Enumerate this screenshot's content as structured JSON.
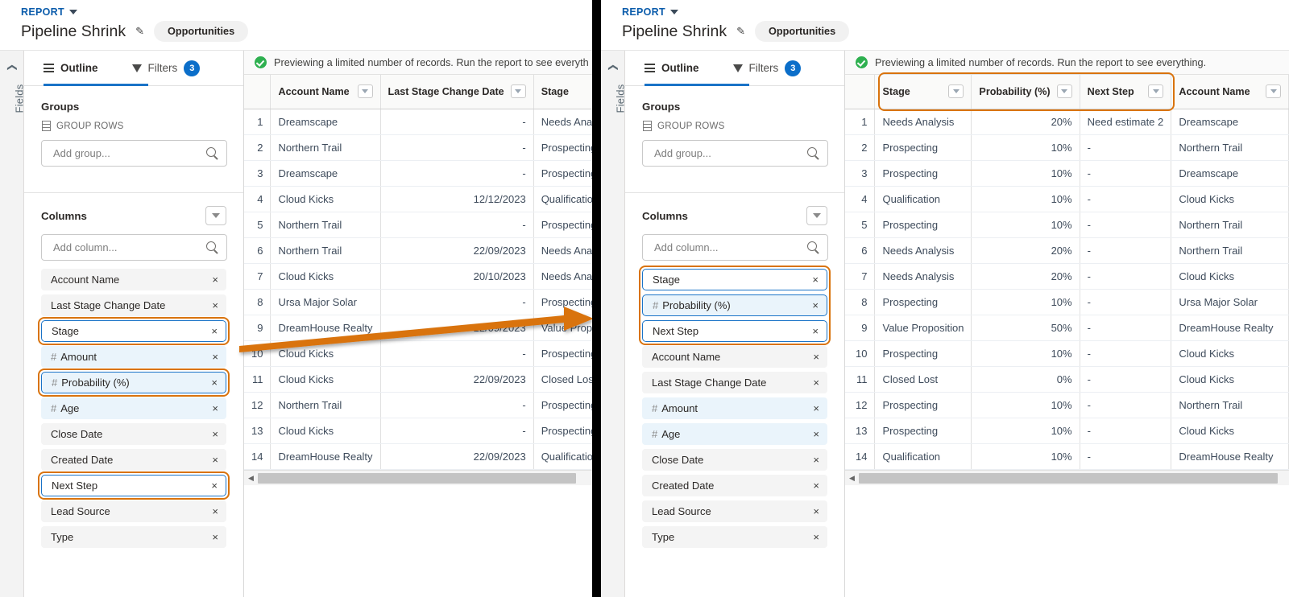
{
  "app": {
    "report_link": "REPORT",
    "report_title": "Pipeline Shrink",
    "object_pill": "Opportunities",
    "fields_rail_label": "Fields",
    "edit_icon": "pencil-icon"
  },
  "outline": {
    "tab_outline": "Outline",
    "tab_filters": "Filters",
    "filters_count": "3",
    "groups_title": "Groups",
    "group_rows_label": "GROUP ROWS",
    "add_group_placeholder": "Add group...",
    "columns_title": "Columns",
    "add_column_placeholder": "Add column...",
    "remove_glyph": "×"
  },
  "columns_left": [
    {
      "label": "Account Name",
      "numeric": false,
      "selected": false,
      "highlighted": false
    },
    {
      "label": "Last Stage Change Date",
      "numeric": false,
      "selected": false,
      "highlighted": false
    },
    {
      "label": "Stage",
      "numeric": false,
      "selected": true,
      "highlighted": true
    },
    {
      "label": "Amount",
      "numeric": true,
      "selected": false,
      "highlighted": false
    },
    {
      "label": "Probability (%)",
      "numeric": true,
      "selected": true,
      "highlighted": true
    },
    {
      "label": "Age",
      "numeric": true,
      "selected": false,
      "highlighted": false
    },
    {
      "label": "Close Date",
      "numeric": false,
      "selected": false,
      "highlighted": false
    },
    {
      "label": "Created Date",
      "numeric": false,
      "selected": false,
      "highlighted": false
    },
    {
      "label": "Next Step",
      "numeric": false,
      "selected": true,
      "highlighted": true
    },
    {
      "label": "Lead Source",
      "numeric": false,
      "selected": false,
      "highlighted": false
    },
    {
      "label": "Type",
      "numeric": false,
      "selected": false,
      "highlighted": false
    }
  ],
  "columns_right": [
    {
      "label": "Stage",
      "numeric": false,
      "selected": true,
      "highlighted": true
    },
    {
      "label": "Probability (%)",
      "numeric": true,
      "selected": true,
      "highlighted": true
    },
    {
      "label": "Next Step",
      "numeric": false,
      "selected": true,
      "highlighted": true
    },
    {
      "label": "Account Name",
      "numeric": false,
      "selected": false,
      "highlighted": false
    },
    {
      "label": "Last Stage Change Date",
      "numeric": false,
      "selected": false,
      "highlighted": false
    },
    {
      "label": "Amount",
      "numeric": true,
      "selected": false,
      "highlighted": false
    },
    {
      "label": "Age",
      "numeric": true,
      "selected": false,
      "highlighted": false
    },
    {
      "label": "Close Date",
      "numeric": false,
      "selected": false,
      "highlighted": false
    },
    {
      "label": "Created Date",
      "numeric": false,
      "selected": false,
      "highlighted": false
    },
    {
      "label": "Lead Source",
      "numeric": false,
      "selected": false,
      "highlighted": false
    },
    {
      "label": "Type",
      "numeric": false,
      "selected": false,
      "highlighted": false
    }
  ],
  "preview_banner": {
    "left_text": "Previewing a limited number of records. Run the report to see everyth",
    "right_text": "Previewing a limited number of records. Run the report to see everything.",
    "icon": "success-check-icon"
  },
  "table_left": {
    "headers": [
      "Account Name",
      "Last Stage Change Date",
      "Stage"
    ],
    "rows": [
      {
        "n": "1",
        "account": "Dreamscape",
        "date": "-",
        "stage": "Needs Analysis"
      },
      {
        "n": "2",
        "account": "Northern Trail",
        "date": "-",
        "stage": "Prospecting"
      },
      {
        "n": "3",
        "account": "Dreamscape",
        "date": "-",
        "stage": "Prospecting"
      },
      {
        "n": "4",
        "account": "Cloud Kicks",
        "date": "12/12/2023",
        "stage": "Qualification"
      },
      {
        "n": "5",
        "account": "Northern Trail",
        "date": "-",
        "stage": "Prospecting"
      },
      {
        "n": "6",
        "account": "Northern Trail",
        "date": "22/09/2023",
        "stage": "Needs Analysis"
      },
      {
        "n": "7",
        "account": "Cloud Kicks",
        "date": "20/10/2023",
        "stage": "Needs Analysis"
      },
      {
        "n": "8",
        "account": "Ursa Major Solar",
        "date": "-",
        "stage": "Prospecting"
      },
      {
        "n": "9",
        "account": "DreamHouse Realty",
        "date": "22/09/2023",
        "stage": "Value Proposition"
      },
      {
        "n": "10",
        "account": "Cloud Kicks",
        "date": "-",
        "stage": "Prospecting"
      },
      {
        "n": "11",
        "account": "Cloud Kicks",
        "date": "22/09/2023",
        "stage": "Closed Lost"
      },
      {
        "n": "12",
        "account": "Northern Trail",
        "date": "-",
        "stage": "Prospecting"
      },
      {
        "n": "13",
        "account": "Cloud Kicks",
        "date": "-",
        "stage": "Prospecting"
      },
      {
        "n": "14",
        "account": "DreamHouse Realty",
        "date": "22/09/2023",
        "stage": "Qualification"
      }
    ]
  },
  "table_right": {
    "headers": [
      "Stage",
      "Probability (%)",
      "Next Step",
      "Account Name"
    ],
    "rows": [
      {
        "n": "1",
        "stage": "Needs Analysis",
        "prob": "20%",
        "next": "Need estimate 2",
        "account": "Dreamscape"
      },
      {
        "n": "2",
        "stage": "Prospecting",
        "prob": "10%",
        "next": "-",
        "account": "Northern Trail"
      },
      {
        "n": "3",
        "stage": "Prospecting",
        "prob": "10%",
        "next": "-",
        "account": "Dreamscape"
      },
      {
        "n": "4",
        "stage": "Qualification",
        "prob": "10%",
        "next": "-",
        "account": "Cloud Kicks"
      },
      {
        "n": "5",
        "stage": "Prospecting",
        "prob": "10%",
        "next": "-",
        "account": "Northern Trail"
      },
      {
        "n": "6",
        "stage": "Needs Analysis",
        "prob": "20%",
        "next": "-",
        "account": "Northern Trail"
      },
      {
        "n": "7",
        "stage": "Needs Analysis",
        "prob": "20%",
        "next": "-",
        "account": "Cloud Kicks"
      },
      {
        "n": "8",
        "stage": "Prospecting",
        "prob": "10%",
        "next": "-",
        "account": "Ursa Major Solar"
      },
      {
        "n": "9",
        "stage": "Value Proposition",
        "prob": "50%",
        "next": "-",
        "account": "DreamHouse Realty"
      },
      {
        "n": "10",
        "stage": "Prospecting",
        "prob": "10%",
        "next": "-",
        "account": "Cloud Kicks"
      },
      {
        "n": "11",
        "stage": "Closed Lost",
        "prob": "0%",
        "next": "-",
        "account": "Cloud Kicks"
      },
      {
        "n": "12",
        "stage": "Prospecting",
        "prob": "10%",
        "next": "-",
        "account": "Northern Trail"
      },
      {
        "n": "13",
        "stage": "Prospecting",
        "prob": "10%",
        "next": "-",
        "account": "Cloud Kicks"
      },
      {
        "n": "14",
        "stage": "Qualification",
        "prob": "10%",
        "next": "-",
        "account": "DreamHouse Realty"
      }
    ]
  },
  "colors": {
    "highlight_orange": "#d9730d",
    "selected_blue": "#1a73c7",
    "link_blue": "#0b5cab",
    "badge_blue": "#0b6ec9",
    "success_green": "#2eb050"
  }
}
